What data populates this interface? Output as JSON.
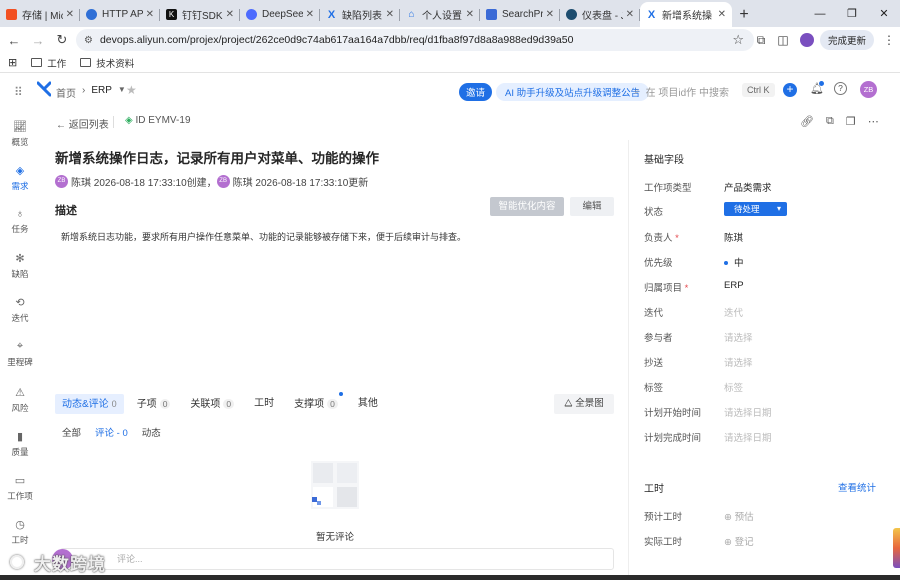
{
  "browser": {
    "tabs": [
      {
        "title": "存储 | Micr",
        "fav_color": "#f25022"
      },
      {
        "title": "HTTP API",
        "fav_color": "#2f6fd6"
      },
      {
        "title": "钉钉SDK",
        "fav_color": "#111111"
      },
      {
        "title": "DeepSeek",
        "fav_color": "#4d6bfe"
      },
      {
        "title": "缺陷列表",
        "fav_color": "#1f6fe5"
      },
      {
        "title": "个人设置",
        "fav_color": "#1f6fe5"
      },
      {
        "title": "SearchPro",
        "fav_color": "#3b6ad6"
      },
      {
        "title": "仪表盘 - Je",
        "fav_color": "#1d4d6f"
      },
      {
        "title": "新增系统操",
        "fav_color": "#1f6fe5"
      }
    ],
    "url": "devops.aliyun.com/projex/project/262ce0d9c74ab617aa164a7dbb/req/d1fba8f97d8a8a988ed9d39a50",
    "finish_update": "完成更新",
    "bookmarks": [
      "工作",
      "技术资料"
    ]
  },
  "header": {
    "home": "首页",
    "project": "ERP",
    "invite": "邀请",
    "banner": "AI 助手升级及站点升级调整公告",
    "search_placeholder": "在 项目id作 中搜索",
    "shortcut": "Ctrl K",
    "avatar": "ZB"
  },
  "leftnav": [
    "概览",
    "需求",
    "任务",
    "缺陷",
    "迭代",
    "里程碑",
    "风险",
    "质量",
    "工作项",
    "工时"
  ],
  "item": {
    "back": "返回列表",
    "id": "ID EYMV-19",
    "title": "新增系统操作日志，记录所有用户对菜单、功能的操作",
    "meta_created": "陈琪 2026-08-18 17:33:10创建，",
    "meta_updated": "陈琪 2026-08-18 17:33:10更新",
    "avatar_initials": "ZB",
    "description_label": "描述",
    "ai_button": "智能优化内容",
    "edit_button": "编辑",
    "description": "新增系统日志功能，要求所有用户操作任意菜单、功能的记录能够被存储下来，便于后续审计与排查。"
  },
  "activity": {
    "tabs": [
      {
        "label": "动态&评论",
        "count": "0"
      },
      {
        "label": "子项",
        "count": "0"
      },
      {
        "label": "关联项",
        "count": "0"
      },
      {
        "label": "工时",
        "count": ""
      },
      {
        "label": "支撑项",
        "count": "0"
      },
      {
        "label": "其他",
        "count": ""
      }
    ],
    "full_view": "全景图",
    "subtabs": [
      "全部",
      "评论 - 0",
      "动态"
    ],
    "empty": "暂无评论",
    "comment_placeholder": "评论..."
  },
  "fields": {
    "section_title": "基础字段",
    "rows": [
      {
        "label": "工作项类型",
        "value": "产品类需求"
      },
      {
        "label": "状态",
        "value": "待处理"
      },
      {
        "label": "负责人",
        "value": "陈琪"
      },
      {
        "label": "优先级",
        "value": "中"
      },
      {
        "label": "归属项目",
        "value": "ERP"
      },
      {
        "label": "迭代",
        "value": "迭代"
      },
      {
        "label": "参与者",
        "value": "请选择"
      },
      {
        "label": "抄送",
        "value": "请选择"
      },
      {
        "label": "标签",
        "value": "标签"
      },
      {
        "label": "计划开始时间",
        "value": "请选择日期"
      },
      {
        "label": "计划完成时间",
        "value": "请选择日期"
      }
    ],
    "worktime_title": "工时",
    "worktime_link": "查看统计",
    "estimate_label": "预计工时",
    "estimate_value": "预估",
    "actual_label": "实际工时",
    "actual_value": "登记"
  },
  "watermark": "大数跨境",
  "colors": {
    "accent": "#1f6fe5",
    "status_bg": "#1f6fe5",
    "required": "#e5484d"
  }
}
